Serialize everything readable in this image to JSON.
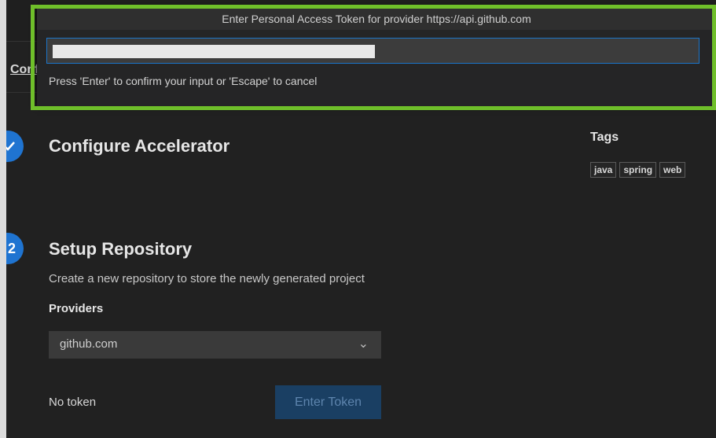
{
  "palette": {
    "title": "Enter Personal Access Token for provider https://api.github.com",
    "hint": "Press 'Enter' to confirm your input or 'Escape' to cancel"
  },
  "breadcrumb": "Configure",
  "steps": [
    {
      "number": "",
      "title": "Configure Accelerator"
    },
    {
      "number": "2",
      "title": "Setup Repository",
      "description": "Create a new repository to store the newly generated project"
    }
  ],
  "tags": {
    "title": "Tags",
    "items": [
      "java",
      "spring",
      "web"
    ]
  },
  "providers": {
    "label": "Providers",
    "selected": "github.com"
  },
  "token": {
    "status": "No token",
    "button": "Enter Token"
  }
}
